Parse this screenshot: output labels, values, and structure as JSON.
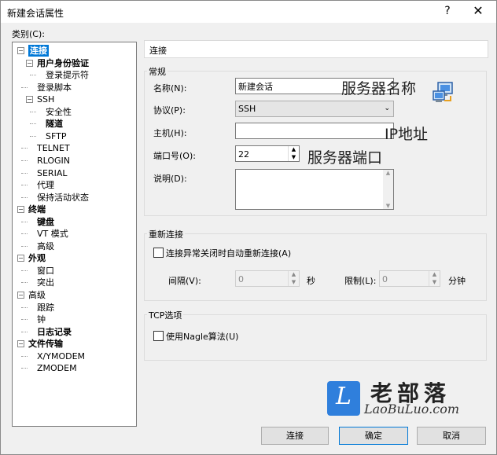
{
  "window": {
    "title": "新建会话属性",
    "help_label": "?",
    "close_label": "✕"
  },
  "category_label": "类别(C):",
  "tree": [
    {
      "label": "连接",
      "depth": 0,
      "bold": true,
      "selected": true,
      "expander": "−"
    },
    {
      "label": "用户身份验证",
      "depth": 1,
      "bold": true,
      "expander": "−"
    },
    {
      "label": "登录提示符",
      "depth": 2
    },
    {
      "label": "登录脚本",
      "depth": 1
    },
    {
      "label": "SSH",
      "depth": 1,
      "expander": "−"
    },
    {
      "label": "安全性",
      "depth": 2
    },
    {
      "label": "隧道",
      "depth": 2,
      "bold": true
    },
    {
      "label": "SFTP",
      "depth": 2
    },
    {
      "label": "TELNET",
      "depth": 1
    },
    {
      "label": "RLOGIN",
      "depth": 1
    },
    {
      "label": "SERIAL",
      "depth": 1
    },
    {
      "label": "代理",
      "depth": 1
    },
    {
      "label": "保持活动状态",
      "depth": 1
    },
    {
      "label": "终端",
      "depth": 0,
      "bold": true,
      "expander": "−"
    },
    {
      "label": "键盘",
      "depth": 1,
      "bold": true
    },
    {
      "label": "VT 模式",
      "depth": 1
    },
    {
      "label": "高级",
      "depth": 1
    },
    {
      "label": "外观",
      "depth": 0,
      "bold": true,
      "expander": "−"
    },
    {
      "label": "窗口",
      "depth": 1
    },
    {
      "label": "突出",
      "depth": 1
    },
    {
      "label": "高级",
      "depth": 0,
      "expander": "−"
    },
    {
      "label": "跟踪",
      "depth": 1
    },
    {
      "label": "钟",
      "depth": 1
    },
    {
      "label": "日志记录",
      "depth": 1,
      "bold": true
    },
    {
      "label": "文件传输",
      "depth": 0,
      "bold": true,
      "expander": "−"
    },
    {
      "label": "X/YMODEM",
      "depth": 1
    },
    {
      "label": "ZMODEM",
      "depth": 1
    }
  ],
  "panel": {
    "header": "连接",
    "general": {
      "title": "常规",
      "name_label": "名称(N):",
      "name_value": "新建会话",
      "protocol_label": "协议(P):",
      "protocol_value": "SSH",
      "host_label": "主机(H):",
      "host_value": "",
      "port_label": "端口号(O):",
      "port_value": "22",
      "desc_label": "说明(D):",
      "desc_value": ""
    },
    "reconnect": {
      "title": "重新连接",
      "checkbox_label": "连接异常关闭时自动重新连接(A)",
      "interval_label": "间隔(V):",
      "interval_value": "0",
      "seconds_unit": "秒",
      "limit_label": "限制(L):",
      "limit_value": "0",
      "minutes_unit": "分钟"
    },
    "tcp": {
      "title": "TCP选项",
      "nagle_label": "使用Nagle算法(U)"
    }
  },
  "annotations": {
    "server_name": "服务器名称",
    "ip": "IP地址",
    "port": "服务器端口"
  },
  "watermark": {
    "cn": "老部落",
    "en": "LaoBuLuo.com",
    "logo_letter": "L"
  },
  "buttons": {
    "connect": "连接",
    "ok": "确定",
    "cancel": "取消"
  },
  "colors": {
    "selection": "#0078d7",
    "logo_blue": "#2f7fdc"
  }
}
